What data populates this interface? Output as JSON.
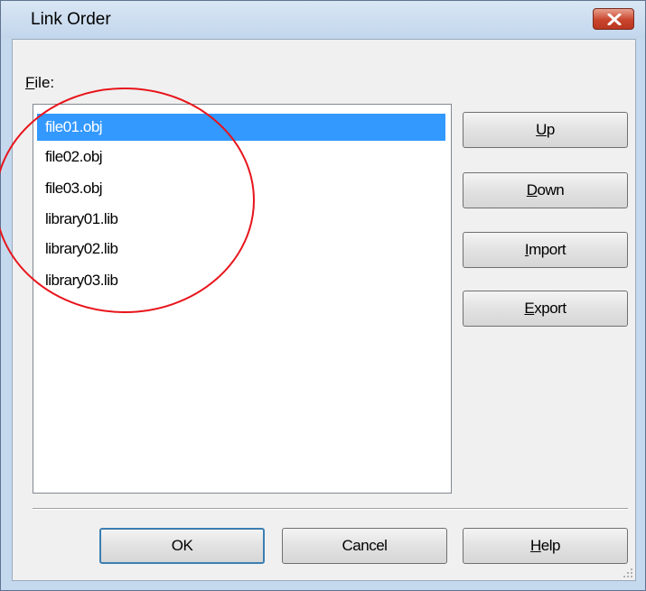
{
  "dialog": {
    "title": "Link Order",
    "close_icon": "close-icon",
    "file_label_accel": "F",
    "file_label_rest": "ile:",
    "files": [
      {
        "name": "file01.obj",
        "selected": true
      },
      {
        "name": "file02.obj",
        "selected": false
      },
      {
        "name": "file03.obj",
        "selected": false
      },
      {
        "name": "library01.lib",
        "selected": false
      },
      {
        "name": "library02.lib",
        "selected": false
      },
      {
        "name": "library03.lib",
        "selected": false
      }
    ],
    "side_buttons": {
      "up": {
        "accel": "U",
        "rest": "p"
      },
      "down": {
        "accel": "D",
        "rest": "own"
      },
      "import": {
        "accel": "I",
        "rest": "mport"
      },
      "export": {
        "accel": "E",
        "rest": "xport"
      }
    },
    "bottom_buttons": {
      "ok": "OK",
      "cancel": "Cancel",
      "help": {
        "accel": "H",
        "rest": "elp"
      }
    }
  },
  "colors": {
    "selection": "#3399ff",
    "annotation": "#e8141b",
    "title_bar": "#c5d9ee"
  }
}
